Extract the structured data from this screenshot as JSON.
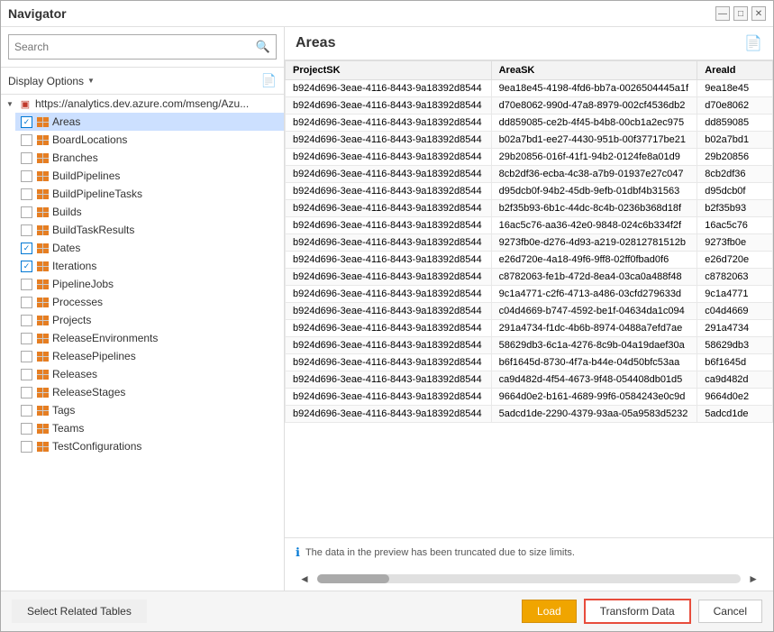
{
  "window": {
    "title": "Navigator",
    "controls": [
      "minimize",
      "maximize",
      "close"
    ]
  },
  "left": {
    "search_placeholder": "Search",
    "display_options_label": "Display Options",
    "root_url": "https://analytics.dev.azure.com/mseng/Azu...",
    "items": [
      {
        "name": "Areas",
        "checked": true,
        "selected": true
      },
      {
        "name": "BoardLocations",
        "checked": false
      },
      {
        "name": "Branches",
        "checked": false
      },
      {
        "name": "BuildPipelines",
        "checked": false
      },
      {
        "name": "BuildPipelineTasks",
        "checked": false
      },
      {
        "name": "Builds",
        "checked": false
      },
      {
        "name": "BuildTaskResults",
        "checked": false
      },
      {
        "name": "Dates",
        "checked": true
      },
      {
        "name": "Iterations",
        "checked": true
      },
      {
        "name": "PipelineJobs",
        "checked": false
      },
      {
        "name": "Processes",
        "checked": false
      },
      {
        "name": "Projects",
        "checked": false
      },
      {
        "name": "ReleaseEnvironments",
        "checked": false
      },
      {
        "name": "ReleasePipelines",
        "checked": false
      },
      {
        "name": "Releases",
        "checked": false
      },
      {
        "name": "ReleaseStages",
        "checked": false
      },
      {
        "name": "Tags",
        "checked": false
      },
      {
        "name": "Teams",
        "checked": false
      },
      {
        "name": "TestConfigurations",
        "checked": false
      }
    ]
  },
  "right": {
    "title": "Areas",
    "columns": [
      "ProjectSK",
      "AreaSK",
      "AreaId"
    ],
    "rows": [
      [
        "b924d696-3eae-4116-8443-9a18392d8544",
        "9ea18e45-4198-4fd6-bb7a-00265044​45a1f",
        "9ea18e45"
      ],
      [
        "b924d696-3eae-4116-8443-9a18392d8544",
        "d70e8062-990d-47a8-8979-002cf4536db2",
        "d70e806​2"
      ],
      [
        "b924d696-3eae-4116-8443-9a18392d8544",
        "dd859085-ce2b-4f45-b4b8-00cb1a2ec975",
        "dd859085"
      ],
      [
        "b924d696-3eae-4116-8443-9a18392d8544",
        "b02a7bd1-ee27-4430-951b-00f37717be21",
        "b02a7bd1"
      ],
      [
        "b924d696-3eae-4116-8443-9a18392d8544",
        "29b20856-016f-41f1-94b2-0124fe8a01d9",
        "29b20856"
      ],
      [
        "b924d696-3eae-4116-8443-9a18392d8544",
        "8cb2df36-ecba-4c38-a7b9-01937e27c047",
        "8cb2df36"
      ],
      [
        "b924d696-3eae-4116-8443-9a18392d8544",
        "d95dcb0f-94b2-45db-9efb-01dbf4b31563",
        "d95dcb0f"
      ],
      [
        "b924d696-3eae-4116-8443-9a18392d8544",
        "b2f35b93-6b1c-44dc-8c4b-0236b368d18f",
        "b2f35b93"
      ],
      [
        "b924d696-3eae-4116-8443-9a18392d8544",
        "16ac5c76-aa36-42e0-9848-024c6b334f2f",
        "16ac5c76"
      ],
      [
        "b924d696-3eae-4116-8443-9a18392d8544",
        "9273fb0e-d276-4d93-a219-02812781512b",
        "9273fb0e"
      ],
      [
        "b924d696-3eae-4116-8443-9a18392d8544",
        "e26d720e-4a18-49f6-9ff8-02ff0fbad0f6",
        "e26d720e"
      ],
      [
        "b924d696-3eae-4116-8443-9a18392d8544",
        "c8782063-fe1b-472d-8ea4-03ca0a488f48",
        "c8782063"
      ],
      [
        "b924d696-3eae-4116-8443-9a18392d8544",
        "9c1a4771-c2f6-4713-a486-03cfd279633d",
        "9c1a4771"
      ],
      [
        "b924d696-3eae-4116-8443-9a18392d8544",
        "c04d4669-b747-4592-be1f-04634da1c094",
        "c04d4669"
      ],
      [
        "b924d696-3eae-4116-8443-9a18392d8544",
        "291a4734-f1dc-4b6b-8974-0488a7efd7ae",
        "291a4734"
      ],
      [
        "b924d696-3eae-4116-8443-9a18392d8544",
        "58629db3-6c1a-4276-8c9b-04a19daef30a",
        "58629db3"
      ],
      [
        "b924d696-3eae-4116-8443-9a18392d8544",
        "b6f1645d-8730-4f7a-b44e-04d50bfc53aa",
        "b6f1645d"
      ],
      [
        "b924d696-3eae-4116-8443-9a18392d8544",
        "ca9d482d-4f54-4673-9f48-054408db01d5",
        "ca9d482d"
      ],
      [
        "b924d696-3eae-4116-8443-9a18392d8544",
        "9664d0e2-b161-4689-99f6-05842​43e0c9d",
        "9664d0e2"
      ],
      [
        "b924d696-3eae-4116-8443-9a18392d8544",
        "5adcd1de-2290-4379-93aa-05a9583d5232",
        "5adcd1de"
      ]
    ],
    "info_text": "The data in the preview has been truncated due to size limits."
  },
  "bottom": {
    "select_related_label": "Select Related Tables",
    "load_label": "Load",
    "transform_label": "Transform Data",
    "cancel_label": "Cancel"
  }
}
